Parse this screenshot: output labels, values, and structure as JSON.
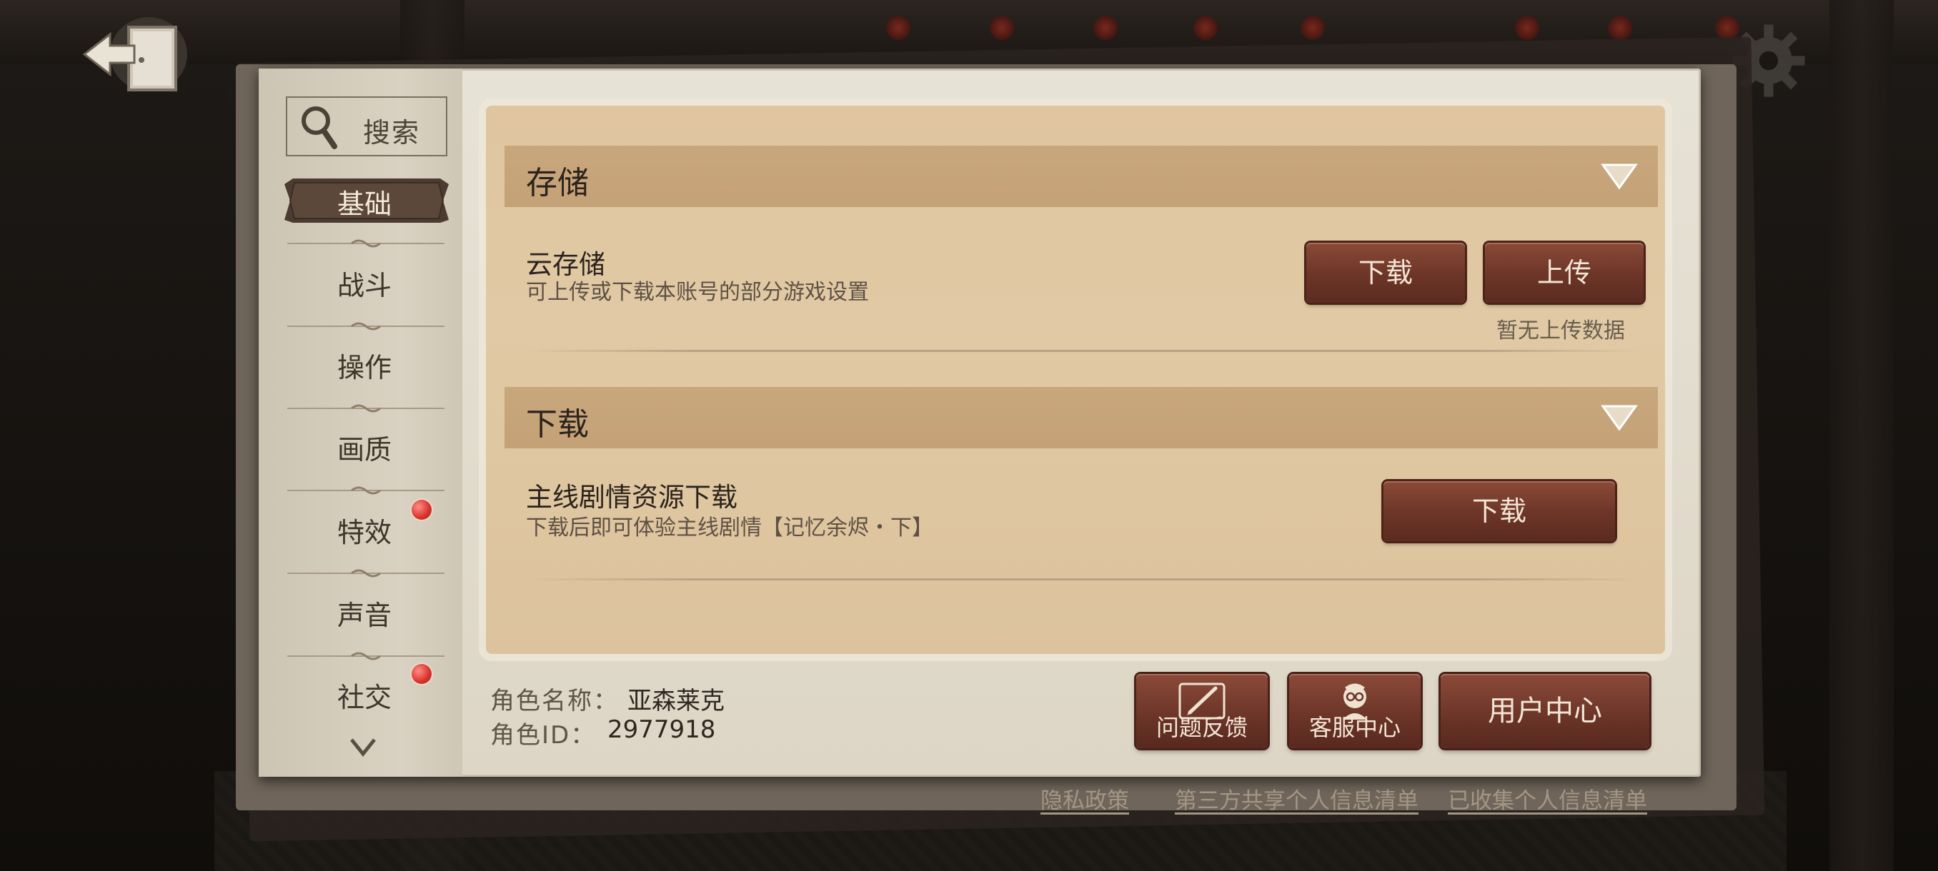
{
  "sidebar": {
    "search_label": "搜索",
    "items": [
      {
        "label": "基础",
        "active": true,
        "badge": false
      },
      {
        "label": "战斗",
        "active": false,
        "badge": false
      },
      {
        "label": "操作",
        "active": false,
        "badge": false
      },
      {
        "label": "画质",
        "active": false,
        "badge": false
      },
      {
        "label": "特效",
        "active": false,
        "badge": true
      },
      {
        "label": "声音",
        "active": false,
        "badge": false
      },
      {
        "label": "社交",
        "active": false,
        "badge": true
      }
    ]
  },
  "sections": {
    "storage": {
      "title": "存储",
      "cloud": {
        "title": "云存储",
        "desc": "可上传或下载本账号的部分游戏设置",
        "download_label": "下载",
        "upload_label": "上传",
        "status": "暂无上传数据"
      }
    },
    "download": {
      "title": "下载",
      "story": {
        "title": "主线剧情资源下载",
        "desc": "下载后即可体验主线剧情【记忆余烬・下】",
        "download_label": "下载"
      }
    }
  },
  "role": {
    "name_label": "角色名称：",
    "name_value": "亚森莱克",
    "id_label": "角色ID：",
    "id_value": "2977918"
  },
  "actions": {
    "feedback_label": "问题反馈",
    "service_label": "客服中心",
    "user_center_label": "用户中心"
  },
  "footer": {
    "privacy": "隐私政策",
    "third_party": "第三方共享个人信息清单",
    "collected": "已收集个人信息清单"
  },
  "colors": {
    "accent_button": "#6c3527",
    "badge": "#d8312b",
    "paper": "#e0c9a4"
  }
}
